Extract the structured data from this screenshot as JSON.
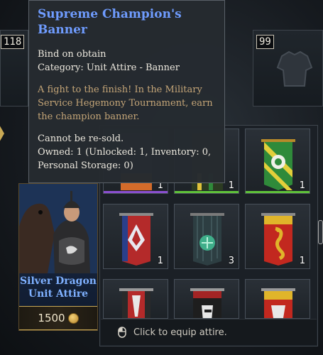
{
  "top_slots": [
    {
      "count": "118"
    },
    {
      "count": "99"
    }
  ],
  "character": {
    "name_line1": "Silver Dragon",
    "name_line2": "Unit Attire",
    "price": "1500",
    "price_icon": "coin-icon"
  },
  "tooltip": {
    "title": "Supreme Champion's Banner",
    "bind": "Bind on obtain",
    "category": "Category: Unit Attire - Banner",
    "flavor_1": "A fight to the finish! In the Military",
    "flavor_2": "Service Hegemony Tournament, earn",
    "flavor_3": "the champion banner.",
    "resale": "Cannot be re-sold.",
    "owned_1": "Owned: 1 (Unlocked: 1, Inventory: 0,",
    "owned_2": "Personal Storage: 0)"
  },
  "inventory": {
    "tiles": [
      {
        "qty": "1",
        "rarity_color": "#8a4fd0"
      },
      {
        "qty": "1",
        "rarity_color": "#5fc23a"
      },
      {
        "qty": "1",
        "rarity_color": "#5fc23a"
      },
      {
        "qty": "1",
        "rarity_color": ""
      },
      {
        "qty": "3",
        "rarity_color": ""
      },
      {
        "qty": "1",
        "rarity_color": ""
      },
      {
        "qty": "",
        "rarity_color": ""
      },
      {
        "qty": "",
        "rarity_color": ""
      },
      {
        "qty": "",
        "rarity_color": ""
      }
    ],
    "footer_text": "Click to equip attire.",
    "footer_icon": "mouse-left-click-icon"
  },
  "colors": {
    "title_blue": "#6f9cff",
    "flavor_gold": "#c4a577",
    "name_blue": "#7fb1ff",
    "price_gold": "#c9a955"
  }
}
